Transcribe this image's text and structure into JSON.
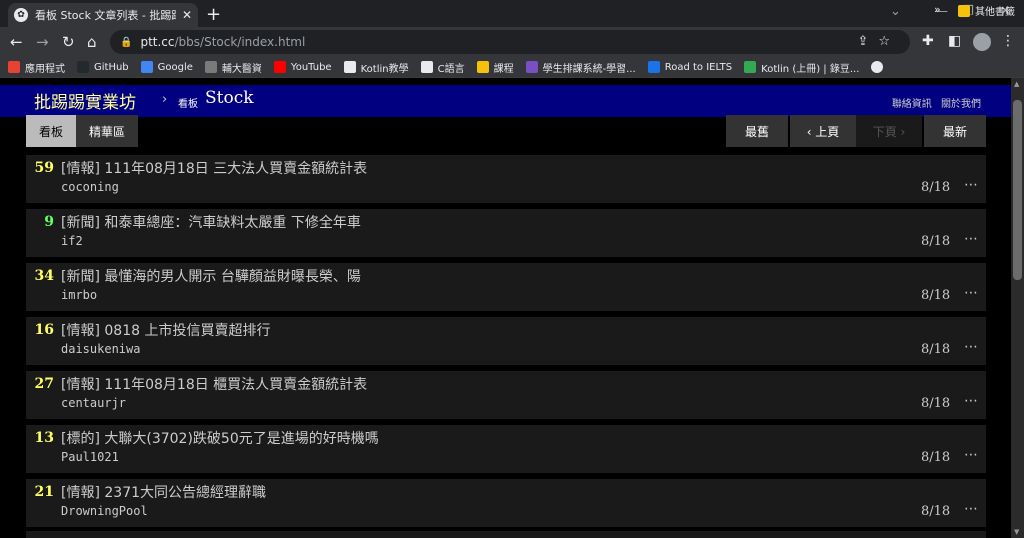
{
  "browser": {
    "tab_title": "看板 Stock 文章列表 - 批踢踢實業",
    "tab_close": "✕",
    "new_tab": "+",
    "window": {
      "minimize": "⌄",
      "restore": "❐",
      "close": "✕"
    },
    "url_host": "ptt.cc",
    "url_path": "/bbs/Stock/index.html",
    "bookmarks": [
      {
        "label": "應用程式",
        "color": "#e94235"
      },
      {
        "label": "GitHub",
        "color": "#24292e"
      },
      {
        "label": "Google",
        "color": "#4285f4"
      },
      {
        "label": "輔大醫資",
        "color": "#7a7a7a"
      },
      {
        "label": "YouTube",
        "color": "#ff0000"
      },
      {
        "label": "Kotlin教學",
        "color": "#e8eaed"
      },
      {
        "label": "C語言",
        "color": "#e8eaed"
      },
      {
        "label": "課程",
        "color": "#f4c20d"
      },
      {
        "label": "學生排課系統-學習...",
        "color": "#7b4fc4"
      },
      {
        "label": "Road to IELTS",
        "color": "#1a73e8"
      },
      {
        "label": "Kotlin (上冊) | 錄豆...",
        "color": "#34a853"
      }
    ],
    "bookmarks_more": "»",
    "bookmarks_other": "其他書籤"
  },
  "site": {
    "logo": "批踢踢實業坊",
    "separator": "›",
    "board_prefix": "看板",
    "board_name": "Stock",
    "link_contact": "聯絡資訊",
    "link_about": "關於我們"
  },
  "subnav": {
    "board": "看板",
    "digest": "精華區",
    "oldest": "最舊",
    "prev": "‹ 上頁",
    "next": "下頁 ›",
    "newest": "最新"
  },
  "posts": [
    {
      "nrec": "59",
      "nrec_color": "#ffff66",
      "title": "[情報] 111年08月18日 三大法人買賣金額統計表",
      "author": "coconing",
      "date": "8/18"
    },
    {
      "nrec": "9",
      "nrec_color": "#66ff66",
      "title": "[新聞] 和泰車總座：汽車缺料太嚴重 下修全年車",
      "author": "if2",
      "date": "8/18"
    },
    {
      "nrec": "34",
      "nrec_color": "#ffff66",
      "title": "[新聞] 最懂海的男人開示 台驊顏益財曝長榮、陽",
      "author": "imrbo",
      "date": "8/18"
    },
    {
      "nrec": "16",
      "nrec_color": "#ffff66",
      "title": "[情報] 0818 上市投信買賣超排行",
      "author": "daisukeniwa",
      "date": "8/18"
    },
    {
      "nrec": "27",
      "nrec_color": "#ffff66",
      "title": "[情報] 111年08月18日 櫃買法人買賣金額統計表",
      "author": "centaurjr",
      "date": "8/18"
    },
    {
      "nrec": "13",
      "nrec_color": "#ffff66",
      "title": "[標的] 大聯大(3702)跌破50元了是進場的好時機嗎",
      "author": "Paul1021",
      "date": "8/18"
    },
    {
      "nrec": "21",
      "nrec_color": "#ffff66",
      "title": "[情報] 2371大同公告總經理辭職",
      "author": "DrowningPool",
      "date": "8/18"
    }
  ],
  "more_symbol": "⋯"
}
